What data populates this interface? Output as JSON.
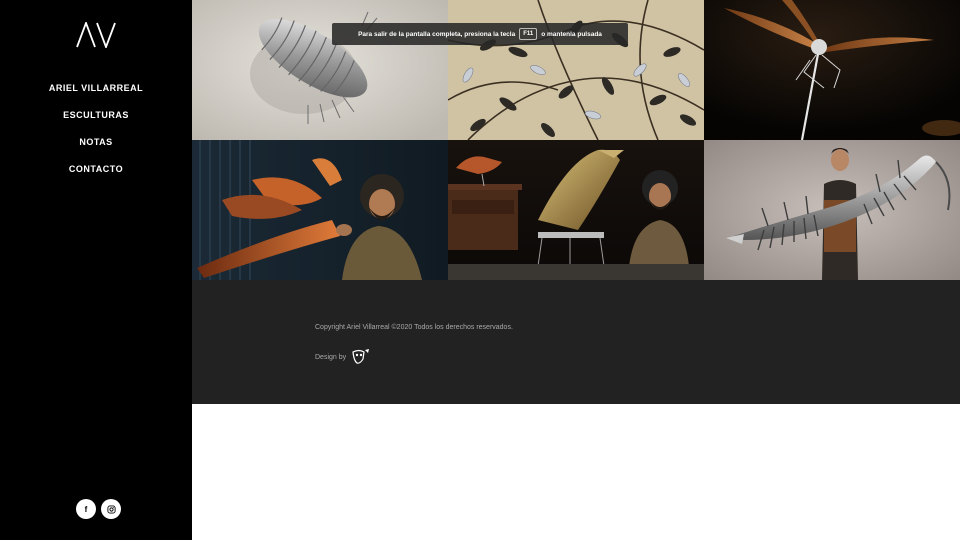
{
  "logo": {
    "text": "AV",
    "icon": "av-monogram-logo"
  },
  "nav": [
    {
      "label": "ARIEL VILLARREAL"
    },
    {
      "label": "ESCULTURAS"
    },
    {
      "label": "NOTAS"
    },
    {
      "label": "CONTACTO"
    }
  ],
  "social": {
    "facebook_icon": "f",
    "instagram_icon": "instagram-icon"
  },
  "gallery": [
    {
      "subject": "metal-isopod-sculpture"
    },
    {
      "subject": "metal-leaves-sculpture"
    },
    {
      "subject": "metal-dragonfly-sculpture"
    },
    {
      "subject": "artist-with-bird-sculpture"
    },
    {
      "subject": "artist-with-piano-bird-sculpture"
    },
    {
      "subject": "artist-with-centipede-sculpture"
    }
  ],
  "footer": {
    "copyright": "Copyright Ariel Villarreal ©2020 Todos los derechos reservados.",
    "design_by": "Design by"
  },
  "fullscreen_toast": {
    "before": "Para salir de la pantalla completa, presiona la tecla",
    "key": "F11",
    "after": "o mantenla pulsada"
  }
}
